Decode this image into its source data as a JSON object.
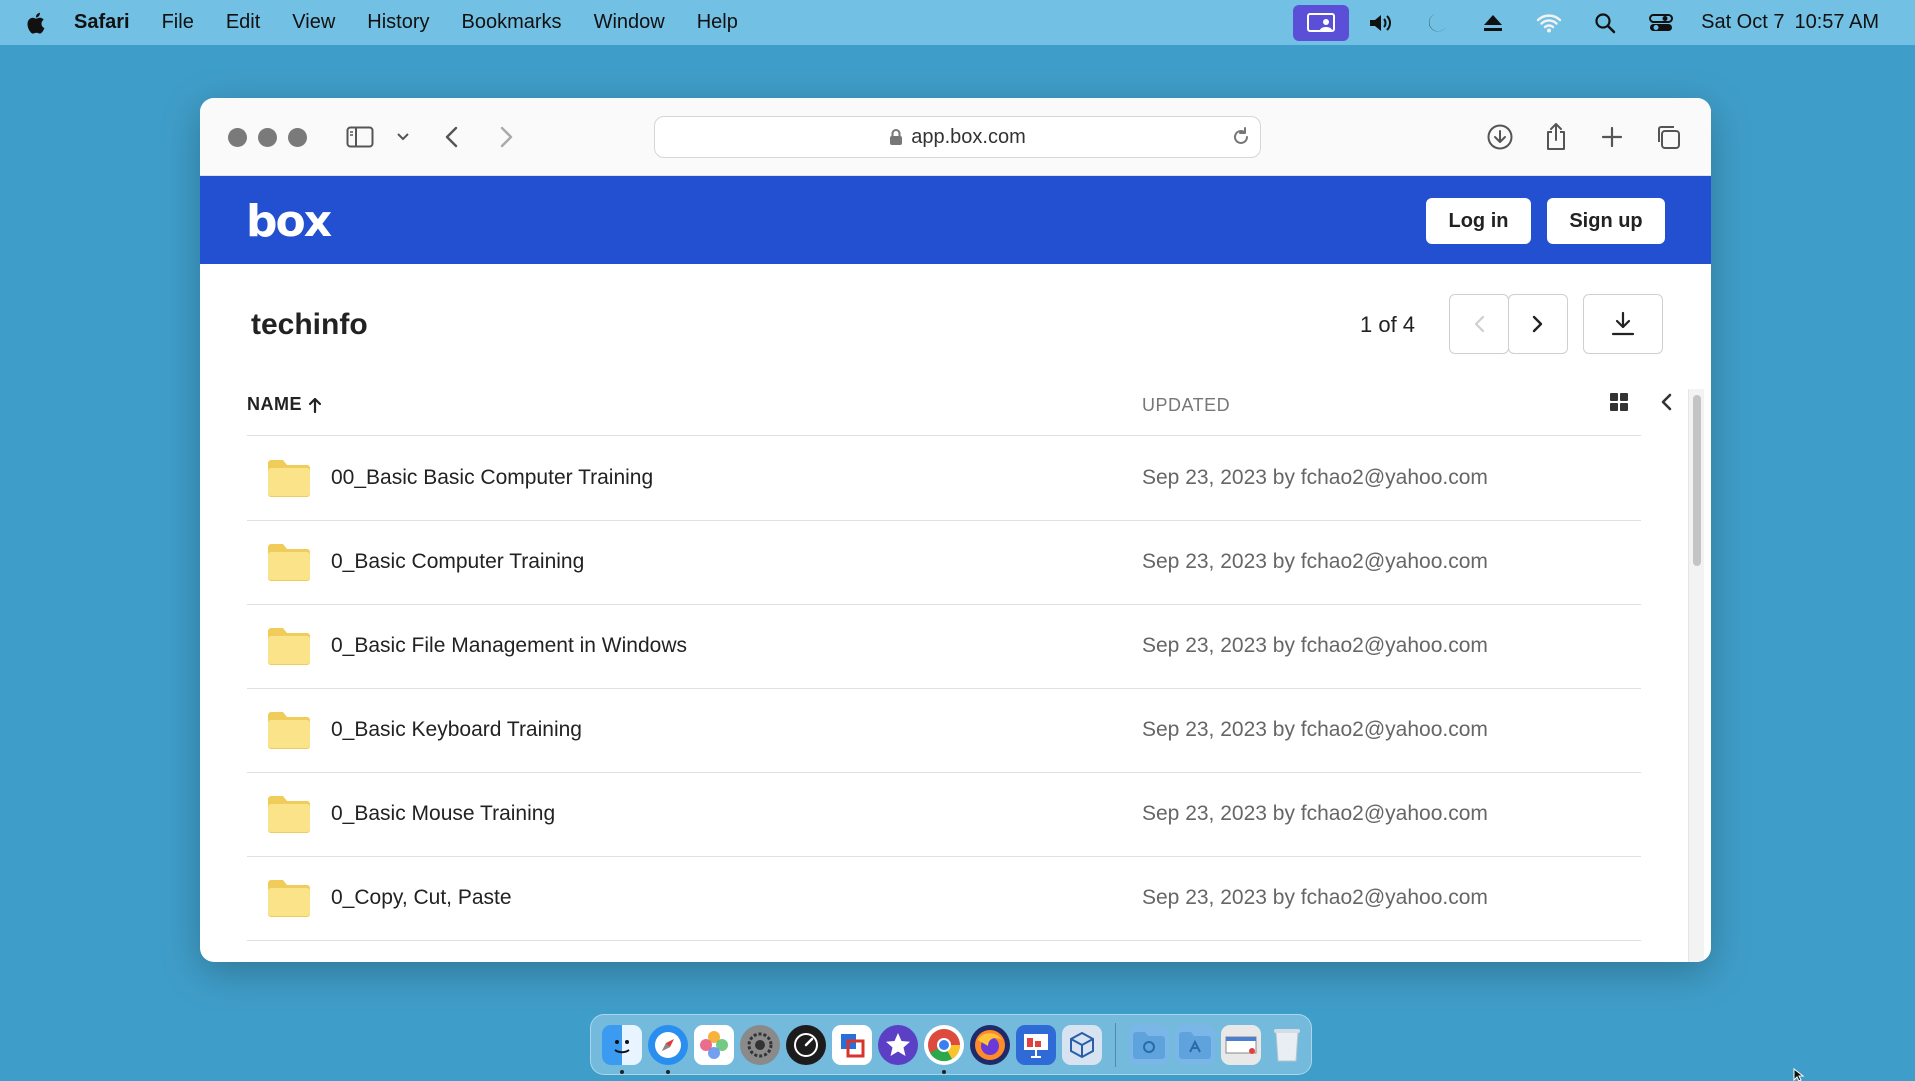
{
  "menubar": {
    "app_name": "Safari",
    "items": [
      "File",
      "Edit",
      "View",
      "History",
      "Bookmarks",
      "Window",
      "Help"
    ],
    "date": "Sat Oct 7",
    "time": "10:57 AM",
    "status_icons": [
      "screen-share-icon",
      "volume-icon",
      "moon-icon",
      "eject-icon",
      "wifi-icon",
      "spotlight-search-icon",
      "control-center-icon"
    ]
  },
  "browser": {
    "url": "app.box.com"
  },
  "box": {
    "logo": "box",
    "login_label": "Log in",
    "signup_label": "Sign up",
    "folder_title": "techinfo",
    "pager_text": "1 of 4",
    "columns": {
      "name": "NAME",
      "updated": "UPDATED"
    },
    "rows": [
      {
        "name": "00_Basic Basic Computer Training",
        "updated": "Sep 23, 2023 by fchao2@yahoo.com"
      },
      {
        "name": "0_Basic Computer Training",
        "updated": "Sep 23, 2023 by fchao2@yahoo.com"
      },
      {
        "name": "0_Basic File Management in Windows",
        "updated": "Sep 23, 2023 by fchao2@yahoo.com"
      },
      {
        "name": "0_Basic Keyboard Training",
        "updated": "Sep 23, 2023 by fchao2@yahoo.com"
      },
      {
        "name": "0_Basic Mouse Training",
        "updated": "Sep 23, 2023 by fchao2@yahoo.com"
      },
      {
        "name": "0_Copy, Cut, Paste",
        "updated": "Sep 23, 2023 by fchao2@yahoo.com"
      }
    ]
  },
  "colors": {
    "desktop": "#3f9ec9",
    "box_blue": "#2250d0",
    "folder_yellow": "#f7dc6f"
  },
  "dock": {
    "apps": [
      "finder-icon",
      "safari-icon",
      "photos-icon",
      "system-settings-icon",
      "activity-monitor-icon",
      "remote-desktop-icon",
      "imovie-icon",
      "chrome-icon",
      "firefox-icon",
      "presentation-icon",
      "virtualbox-icon"
    ],
    "extras": [
      "downloads-folder-icon",
      "applications-folder-icon",
      "screenshot-icon",
      "trash-icon"
    ]
  }
}
